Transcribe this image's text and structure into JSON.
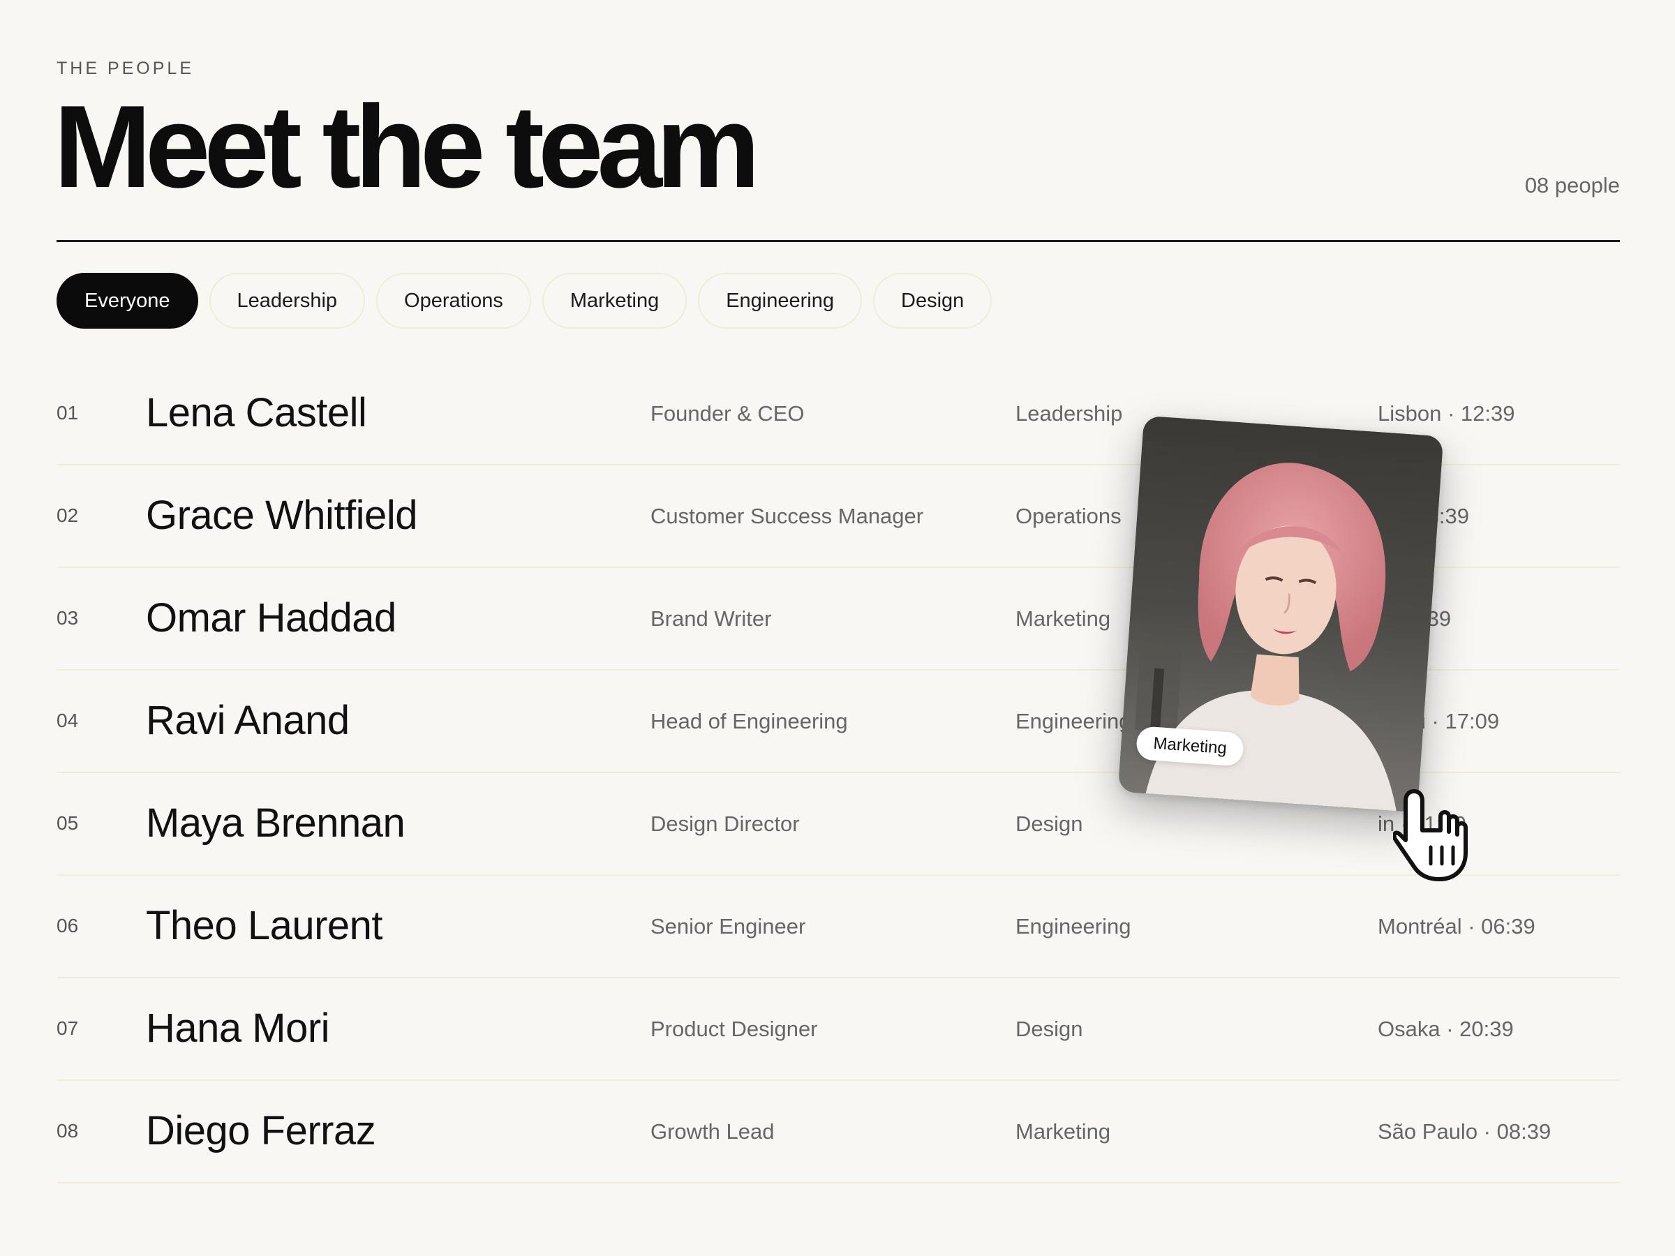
{
  "header": {
    "eyebrow": "THE PEOPLE",
    "title": "Meet the team",
    "count": "08 people"
  },
  "filters": [
    {
      "label": "Everyone",
      "active": true
    },
    {
      "label": "Leadership",
      "active": false
    },
    {
      "label": "Operations",
      "active": false
    },
    {
      "label": "Marketing",
      "active": false
    },
    {
      "label": "Engineering",
      "active": false
    },
    {
      "label": "Design",
      "active": false
    }
  ],
  "people": [
    {
      "num": "01",
      "name": "Lena Castell",
      "role": "Founder & CEO",
      "dept": "Leadership",
      "loc": "Lisbon · 12:39"
    },
    {
      "num": "02",
      "name": "Grace Whitfield",
      "role": "Customer Success Manager",
      "dept": "Operations",
      "loc": "rk · 08:39"
    },
    {
      "num": "03",
      "name": "Omar Haddad",
      "role": "Brand Writer",
      "dept": "Marketing",
      "loc": "n · 1:39"
    },
    {
      "num": "04",
      "name": "Ravi Anand",
      "role": "Head of Engineering",
      "dept": "Engineering",
      "loc": "aluru · 17:09"
    },
    {
      "num": "05",
      "name": "Maya Brennan",
      "role": "Design Director",
      "dept": "Design",
      "loc": "in · 11:39"
    },
    {
      "num": "06",
      "name": "Theo Laurent",
      "role": "Senior Engineer",
      "dept": "Engineering",
      "loc": "Montréal · 06:39"
    },
    {
      "num": "07",
      "name": "Hana Mori",
      "role": "Product Designer",
      "dept": "Design",
      "loc": "Osaka · 20:39"
    },
    {
      "num": "08",
      "name": "Diego Ferraz",
      "role": "Growth Lead",
      "dept": "Marketing",
      "loc": "São Paulo · 08:39"
    }
  ],
  "hover_card": {
    "tag": "Marketing",
    "icons": {
      "photo": "portrait-photo",
      "cursor": "pointer-hand-icon"
    }
  },
  "colors": {
    "background": "#f8f7f4",
    "text": "#111111",
    "muted": "#666666",
    "active_pill": "#0b0b0b",
    "row_divider": "#f4edd6"
  }
}
